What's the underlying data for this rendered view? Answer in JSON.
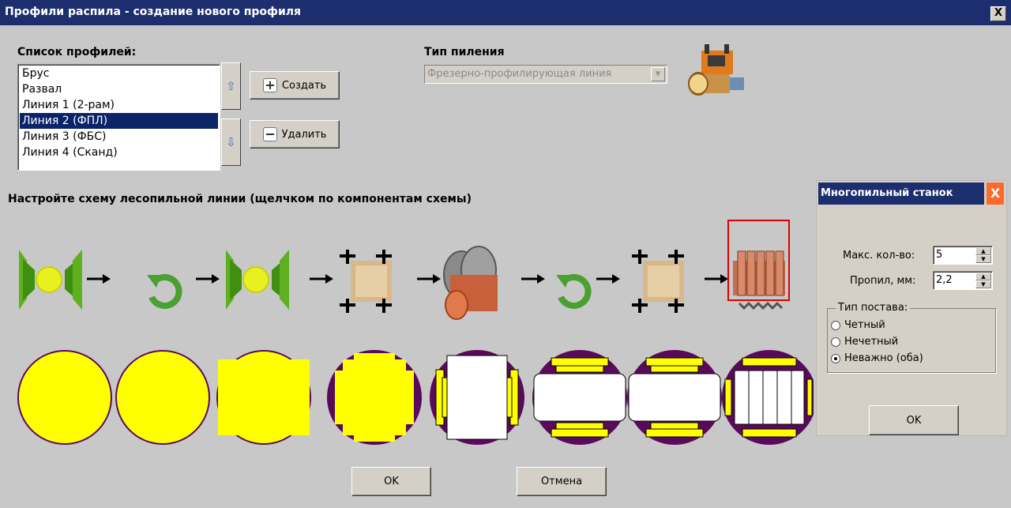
{
  "window": {
    "title": "Профили распила - создание нового профиля",
    "close_label": "X"
  },
  "profiles": {
    "label": "Список профилей:",
    "items": [
      "Брус",
      "Развал",
      "Линия 1 (2-рам)",
      "Линия 2 (ФПЛ)",
      "Линия 3 (ФБС)",
      "Линия 4 (Сканд)"
    ],
    "selected": "Линия 2 (ФПЛ)",
    "create_label": "Создать",
    "delete_label": "Удалить",
    "up_arrow": "⇧",
    "down_arrow": "⇩"
  },
  "saw_type": {
    "label": "Тип пиления",
    "value": "Фрезерно-профилирующая линия",
    "dropdown_arrow": "▼"
  },
  "scheme": {
    "label": "Настройте схему лесопильной линии (щелчком по компонентам схемы)",
    "components": [
      "chipper-canter",
      "rotate",
      "chipper-canter",
      "profiler",
      "circular-saw",
      "rotate",
      "profiler",
      "gang-saw"
    ]
  },
  "colors": {
    "accent": "#0a246a",
    "log": "#ffff00",
    "rim": "#5a0a5a",
    "selection": "#e00000"
  },
  "gang_saw_panel": {
    "title": "Многопильный станок",
    "close_label": "X",
    "max_count_label": "Макс. кол-во:",
    "max_count_value": "5",
    "kerf_label": "Пропил, мм:",
    "kerf_value": "2,2",
    "group_label": "Тип постава:",
    "options": [
      "Четный",
      "Нечетный",
      "Неважно (оба)"
    ],
    "selected_option": "Неважно (оба)",
    "ok_label": "OK"
  },
  "footer": {
    "ok_label": "OK",
    "cancel_label": "Отмена"
  }
}
